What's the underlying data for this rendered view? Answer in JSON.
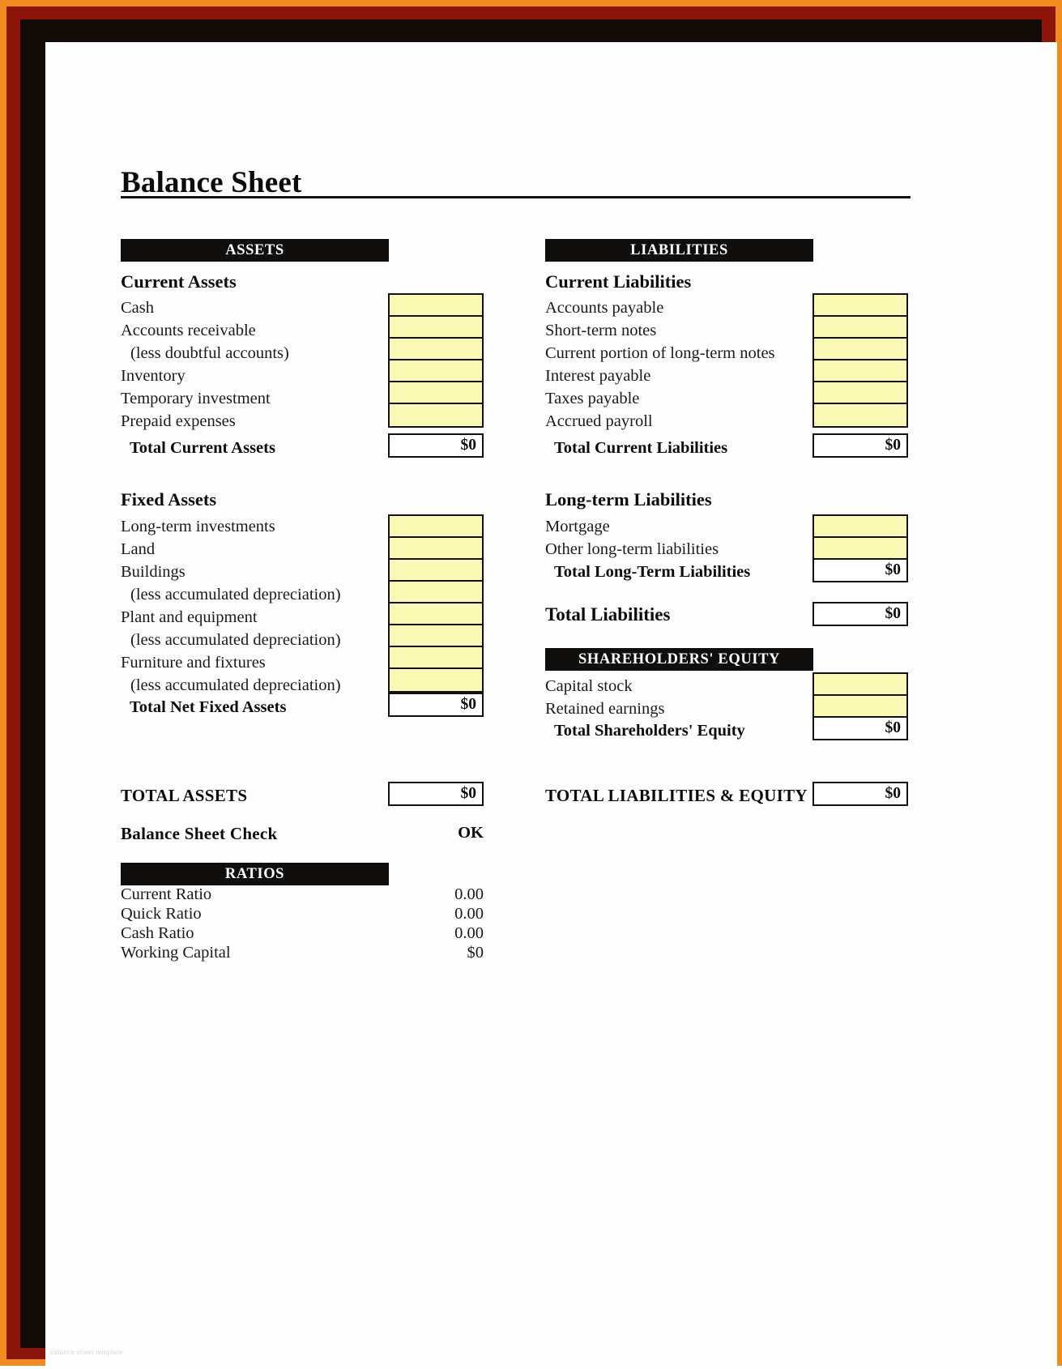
{
  "document": {
    "title": "Balance Sheet",
    "watermark": "balance sheet template"
  },
  "assets": {
    "band_label": "ASSETS",
    "current": {
      "heading": "Current Assets",
      "items": [
        {
          "label": "Cash",
          "value": ""
        },
        {
          "label": "Accounts receivable",
          "value": ""
        },
        {
          "label": "(less doubtful accounts)",
          "value": ""
        },
        {
          "label": "Inventory",
          "value": ""
        },
        {
          "label": "Temporary investment",
          "value": ""
        },
        {
          "label": "Prepaid expenses",
          "value": ""
        }
      ],
      "total_label": "Total Current Assets",
      "total_value": "$0"
    },
    "fixed": {
      "heading": "Fixed Assets",
      "items": [
        {
          "label": "Long-term investments",
          "value": ""
        },
        {
          "label": "Land",
          "value": ""
        },
        {
          "label": "Buildings",
          "value": ""
        },
        {
          "label": "(less accumulated depreciation)",
          "value": ""
        },
        {
          "label": "Plant and equipment",
          "value": ""
        },
        {
          "label": "(less accumulated depreciation)",
          "value": ""
        },
        {
          "label": "Furniture and fixtures",
          "value": ""
        },
        {
          "label": "(less accumulated depreciation)",
          "value": ""
        }
      ],
      "total_label": "Total Net Fixed Assets",
      "total_value": "$0"
    },
    "grand_total_label": "TOTAL ASSETS",
    "grand_total_value": "$0"
  },
  "liabilities": {
    "band_label": "LIABILITIES",
    "current": {
      "heading": "Current Liabilities",
      "items": [
        {
          "label": "Accounts payable",
          "value": ""
        },
        {
          "label": "Short-term notes",
          "value": ""
        },
        {
          "label": "Current portion of long-term notes",
          "value": ""
        },
        {
          "label": "Interest payable",
          "value": ""
        },
        {
          "label": "Taxes payable",
          "value": ""
        },
        {
          "label": "Accrued payroll",
          "value": ""
        }
      ],
      "total_label": "Total Current Liabilities",
      "total_value": "$0"
    },
    "longterm": {
      "heading": "Long-term Liabilities",
      "items": [
        {
          "label": "Mortgage",
          "value": ""
        },
        {
          "label": "Other long-term liabilities",
          "value": ""
        }
      ],
      "total_label": "Total Long-Term Liabilities",
      "total_value": "$0"
    },
    "total_label": "Total Liabilities",
    "total_value": "$0"
  },
  "equity": {
    "band_label": "SHAREHOLDERS' EQUITY",
    "items": [
      {
        "label": "Capital stock",
        "value": ""
      },
      {
        "label": "Retained earnings",
        "value": ""
      }
    ],
    "total_label": "Total Shareholders' Equity",
    "total_value": "$0",
    "grand_total_label": "TOTAL LIABILITIES & EQUITY",
    "grand_total_value": "$0"
  },
  "check": {
    "label": "Balance Sheet Check",
    "value": "OK"
  },
  "ratios": {
    "band_label": "RATIOS",
    "rows": [
      {
        "label": "Current Ratio",
        "value": "0.00"
      },
      {
        "label": "Quick Ratio",
        "value": "0.00"
      },
      {
        "label": "Cash Ratio",
        "value": "0.00"
      },
      {
        "label": "Working Capital",
        "value": "$0"
      }
    ]
  },
  "colors": {
    "input_fill": "#fafab4",
    "band_bg": "#100f0d",
    "frame_outer": "#f08b1d",
    "frame_mid": "#8c1408",
    "frame_inner": "#120a06"
  }
}
